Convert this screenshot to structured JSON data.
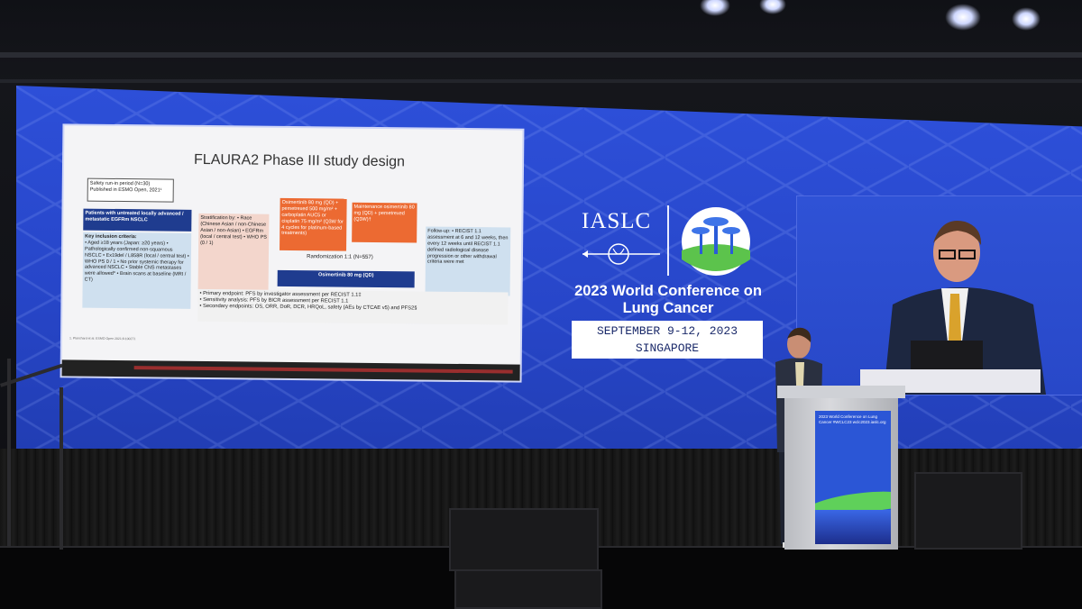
{
  "slide": {
    "title": "FLAURA2 Phase III study design",
    "safety_runin": "Safety run-in period (N=30) Published in ESMO Open, 2021¹",
    "patients": "Patients with untreated locally advanced / metastatic EGFRm NSCLC",
    "key_criteria_heading": "Key inclusion criteria:",
    "key_criteria": "• Aged ≥18 years (Japan: ≥20 years) • Pathologically confirmed non-squamous NSCLC • Ex19del / L858R (local / central test) • WHO PS 0 / 1 • No prior systemic therapy for advanced NSCLC • Stable CNS metastases were allowed* • Brain scans at baseline (MRI / CT)",
    "stratification": "Stratification by: • Race (Chinese Asian / non-Chinese Asian / non-Asian) • EGFRm (local / central test) • WHO PS (0 / 1)",
    "arm_combo": "Osimertinib 80 mg (QD) + pemetrexed 500 mg/m² + carboplatin AUC5 or cisplatin 75 mg/m² (Q3W for 4 cycles for platinum-based treatments)",
    "maintenance": "Maintenance osimertinib 80 mg (QD) + pemetrexed (Q3W)†",
    "randomization": "Randomization 1:1 (N=557)",
    "arm_mono": "Osimertinib 80 mg (QD)",
    "followup": "Follow-up: • RECIST 1.1 assessment at 6 and 12 weeks, then every 12 weeks until RECIST 1.1 defined radiological disease progression or other withdrawal criteria were met",
    "primary_endpoint": "• Primary endpoint: PFS by investigator assessment per RECIST 1.1‡",
    "sensitivity": "• Sensitivity analysis: PFS by BICR assessment per RECIST 1.1",
    "secondary_endpoints": "• Secondary endpoints: OS, ORR, DoR, DCR, HRQoL, safety (AEs by CTCAE v5) and PFS2§",
    "footnote": "1. Planchard et al. ESMO Open 2021;6:100271"
  },
  "branding": {
    "org": "IASLC",
    "conference_title": "2023 World Conference on Lung Cancer",
    "dates": "SEPTEMBER 9-12, 2023",
    "location": "SINGAPORE"
  },
  "podium": {
    "text": "2023 World Conference on Lung Cancer #WCLC23 wclc2023.iaslc.org"
  },
  "colors": {
    "screen_blue": "#2746c9",
    "slide_navy": "#1f3c8f",
    "slide_orange": "#ec6a32",
    "slide_lightblue": "#cfe0ef"
  }
}
